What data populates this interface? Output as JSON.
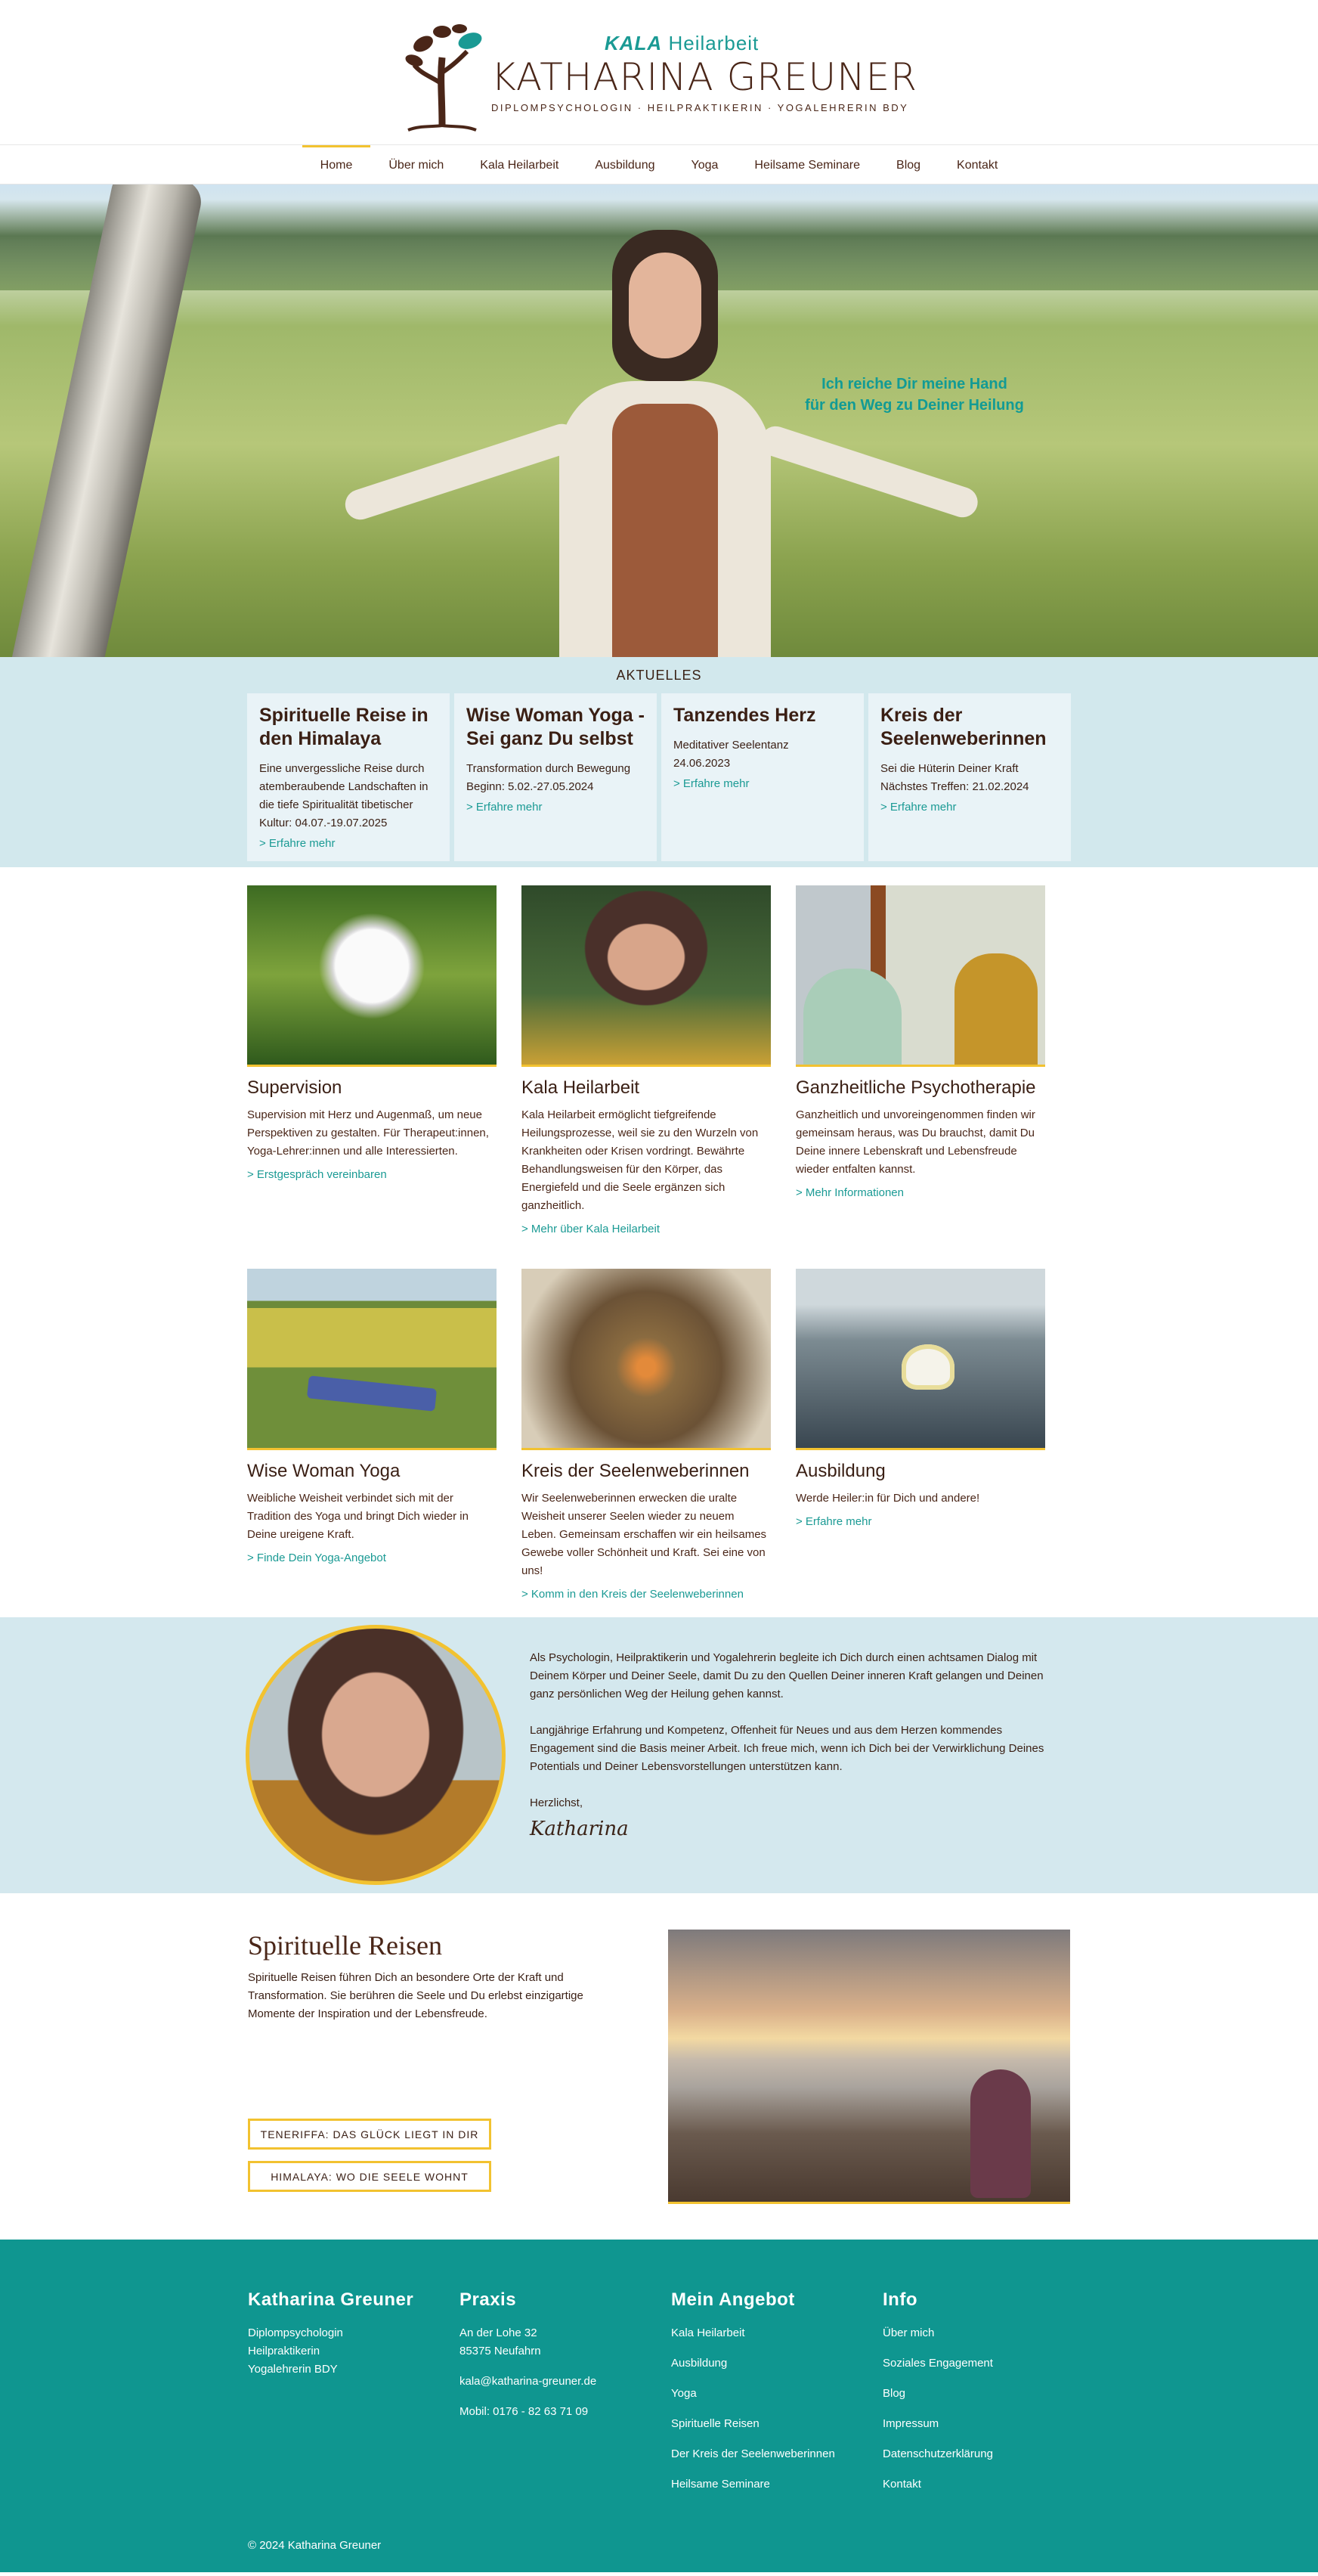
{
  "brand": {
    "kala_prefix": "KALA",
    "kala_suffix": "Heilarbeit",
    "name": "KATHARINA GREUNER",
    "tagline": "DIPLOMPSYCHOLOGIN · HEILPRAKTIKERIN · YOGALEHRERIN BDY"
  },
  "nav": [
    "Home",
    "Über mich",
    "Kala Heilarbeit",
    "Ausbildung",
    "Yoga",
    "Heilsame Seminare",
    "Blog",
    "Kontakt"
  ],
  "hero": {
    "quote_line1": "Ich reiche Dir meine Hand",
    "quote_line2": "für den Weg zu Deiner Heilung"
  },
  "news": {
    "title": "AKTUELLES",
    "cards": [
      {
        "title": "Spirituelle Reise in den Himalaya",
        "text": "Eine unvergessliche Reise durch atemberaubende Landschaften in die tiefe Spiritualität tibetischer Kultur: 04.07.-19.07.2025",
        "link": "> Erfahre mehr"
      },
      {
        "title": "Wise Woman Yoga - Sei ganz Du selbst",
        "text": "Transformation durch Bewegung Beginn: 5.02.-27.05.2024",
        "link": "> Erfahre mehr"
      },
      {
        "title": "Tanzendes Herz",
        "text": "Meditativer Seelentanz\n24.06.2023",
        "link": "> Erfahre mehr"
      },
      {
        "title": "Kreis der Seelenweberinnen",
        "text": "Sei die Hüterin Deiner Kraft Nächstes Treffen: 21.02.2024",
        "link": "> Erfahre mehr"
      }
    ]
  },
  "services": [
    {
      "title": "Supervision",
      "text": "Supervision mit Herz und Augenmaß, um neue Perspektiven zu gestalten. Für Therapeut:innen, Yoga-Lehrer:innen und alle Interessierten.",
      "link": "> Erstgespräch vereinbaren"
    },
    {
      "title": "Kala Heilarbeit",
      "text": "Kala Heilarbeit ermöglicht tiefgreifende Heilungsprozesse, weil sie zu den Wurzeln von Krankheiten oder Krisen vordringt. Bewährte Behandlungsweisen für den Körper, das Energiefeld und die Seele ergänzen sich ganzheitlich.",
      "link": "> Mehr über Kala Heilarbeit"
    },
    {
      "title": "Ganzheitliche Psychotherapie",
      "text": "Ganzheitlich und unvoreingenommen finden wir gemeinsam heraus, was Du brauchst, damit Du Deine innere Lebenskraft und Lebensfreude wieder entfalten kannst.",
      "link": "> Mehr Informationen"
    },
    {
      "title": "Wise Woman Yoga",
      "text": "Weibliche Weisheit verbindet sich mit der Tradition des Yoga und bringt Dich wieder in Deine ureigene Kraft.",
      "link": "> Finde Dein Yoga-Angebot"
    },
    {
      "title": "Kreis der Seelenweberinnen",
      "text": "Wir Seelenweberinnen erwecken die uralte Weisheit unserer Seelen wieder zu neuem Leben. Gemeinsam erschaffen wir ein heilsames Gewebe voller Schönheit und Kraft. Sei eine von uns!",
      "link": "> Komm in den Kreis der Seelenweberinnen"
    },
    {
      "title": "Ausbildung",
      "text": "Werde Heiler:in für Dich und andere!",
      "link": "> Erfahre mehr"
    }
  ],
  "about": {
    "p1": "Als Psychologin, Heilpraktikerin und Yogalehrerin begleite ich Dich durch einen achtsamen Dialog mit Deinem Körper und Deiner Seele, damit Du zu den Quellen Deiner inneren Kraft gelangen und Deinen ganz persönlichen Weg der Heilung gehen kannst.",
    "p2": "Langjährige Erfahrung und Kompetenz, Offenheit für Neues und aus dem Herzen kommendes Engagement sind die Basis meiner Arbeit. Ich freue mich, wenn ich Dich bei der Verwirklichung Deines Potentials und Deiner Lebensvorstellungen unterstützen kann.",
    "greeting": "Herzlichst,",
    "signature": "Katharina"
  },
  "journeys": {
    "title": "Spirituelle Reisen",
    "text": "Spirituelle Reisen führen Dich an besondere Orte der Kraft und Transformation. Sie berühren die Seele und Du erlebst einzigartige Momente der Inspiration und der Lebensfreude.",
    "btn1": "TENERIFFA: DAS GLÜCK LIEGT IN DIR",
    "btn2": "HIMALAYA: WO DIE SEELE WOHNT"
  },
  "footer": {
    "col1": {
      "title": "Katharina Greuner",
      "lines": [
        "Diplompsychologin",
        "Heilpraktikerin",
        "Yogalehrerin BDY"
      ]
    },
    "col2": {
      "title": "Praxis",
      "street": "An der Lohe 32",
      "city": "85375 Neufahrn",
      "email": "kala@katharina-greuner.de",
      "phone": "Mobil: 0176 - 82 63 71 09"
    },
    "col3": {
      "title": "Mein Angebot",
      "items": [
        "Kala Heilarbeit",
        "Ausbildung",
        "Yoga",
        "Spirituelle Reisen",
        "Der Kreis der Seelenweberinnen",
        "Heilsame Seminare"
      ]
    },
    "col4": {
      "title": "Info",
      "items": [
        "Über mich",
        "Soziales Engagement",
        "Blog",
        "Impressum",
        "Datenschutzerklärung",
        "Kontakt"
      ]
    },
    "copyright": "© 2024 Katharina Greuner"
  },
  "colors": {
    "accent": "#f2c230",
    "teal": "#0f9690",
    "brown": "#4a2618"
  }
}
